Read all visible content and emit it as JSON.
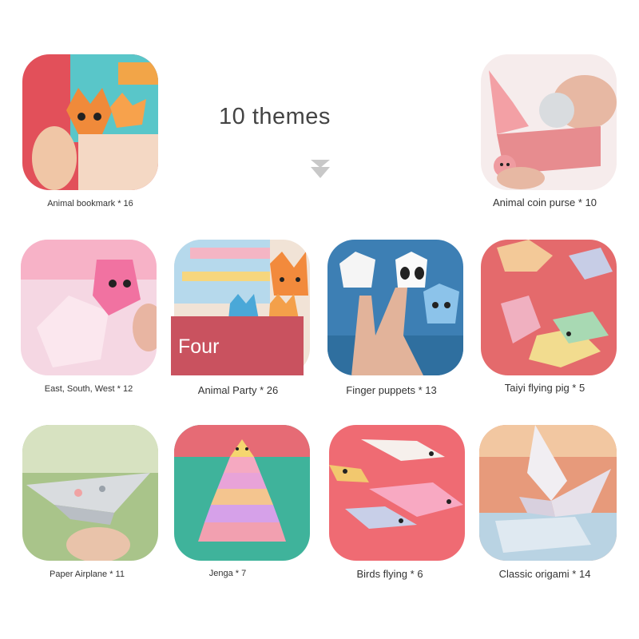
{
  "title": "10 themes",
  "overlay_label": "Four",
  "items": [
    {
      "caption": "Animal bookmark * 16",
      "icon": "tiger-bookmark-icon"
    },
    {
      "caption": "Animal coin purse * 10",
      "icon": "rabbit-coin-purse-icon"
    },
    {
      "caption": "East, South, West * 12",
      "icon": "fortune-teller-icon"
    },
    {
      "caption": "Animal Party * 26",
      "icon": "fox-face-icon"
    },
    {
      "caption": "Finger puppets * 13",
      "icon": "finger-puppet-icon"
    },
    {
      "caption": "Taiyi flying pig * 5",
      "icon": "flying-pig-icon"
    },
    {
      "caption": "Paper Airplane * 11",
      "icon": "paper-airplane-icon"
    },
    {
      "caption": "Jenga * 7",
      "icon": "jenga-tower-icon"
    },
    {
      "caption": "Birds flying * 6",
      "icon": "flying-bird-icon"
    },
    {
      "caption": "Classic origami * 14",
      "icon": "origami-crane-icon"
    }
  ],
  "colors": {
    "accent_red": "#c9525f",
    "arrow_gray": "#c8c8c8"
  }
}
